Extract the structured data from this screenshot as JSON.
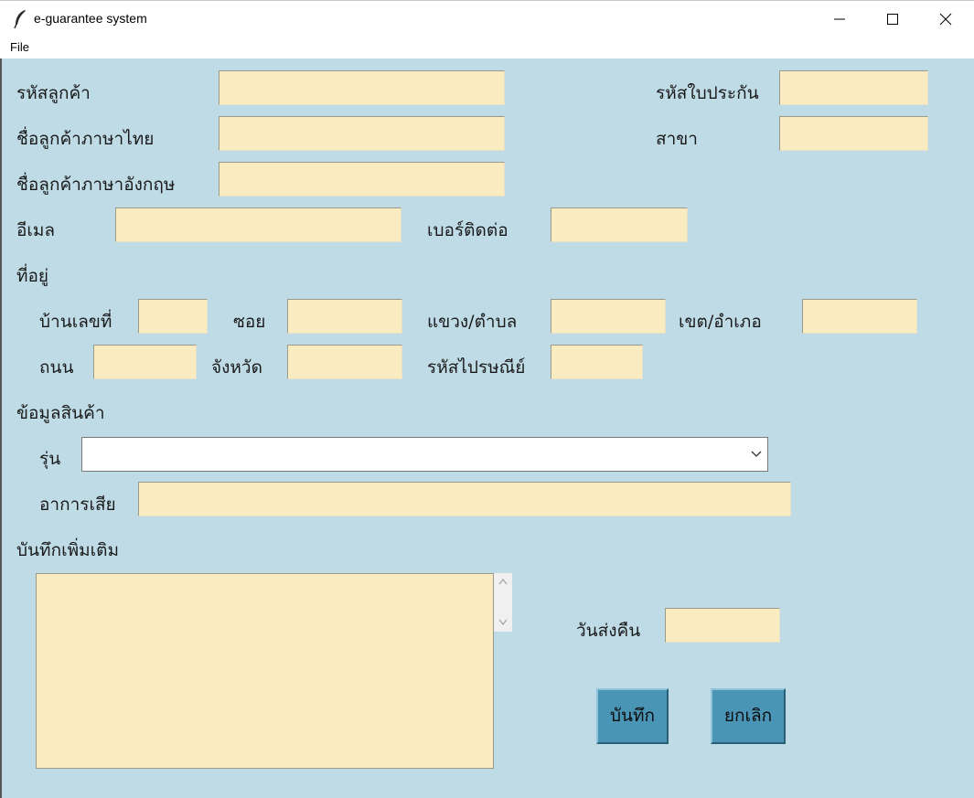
{
  "window": {
    "title": "e-guarantee system"
  },
  "menu": {
    "file": "File"
  },
  "customer": {
    "code_label": "รหัสลูกค้า",
    "name_th_label": "ชื่อลูกค้าภาษาไทย",
    "name_en_label": "ชื่อลูกค้าภาษาอังกฤษ",
    "email_label": "อีเมล",
    "phone_label": "เบอร์ติดต่อ"
  },
  "warranty": {
    "cert_label": "รหัสใบประกัน",
    "branch_label": "สาขา"
  },
  "address": {
    "section_label": "ที่อยู่",
    "house_no_label": "บ้านเลขที่",
    "soi_label": "ซอย",
    "subdistrict_label": "แขวง/ตำบล",
    "district_label": "เขต/อำเภอ",
    "road_label": "ถนน",
    "province_label": "จังหวัด",
    "postcode_label": "รหัสไปรษณีย์"
  },
  "product": {
    "section_label": "ข้อมูลสินค้า",
    "model_label": "รุ่น",
    "model_value": "",
    "symptom_label": "อาการเสีย"
  },
  "notes": {
    "label": "บันทึกเพิ่มเติม"
  },
  "return": {
    "date_label": "วันส่งคืน"
  },
  "buttons": {
    "save": "บันทึก",
    "cancel": "ยกเลิก"
  },
  "colors": {
    "form_bg": "#bfdbe6",
    "entry_bg": "#fbebc0",
    "button_bg": "#4a95b6"
  }
}
